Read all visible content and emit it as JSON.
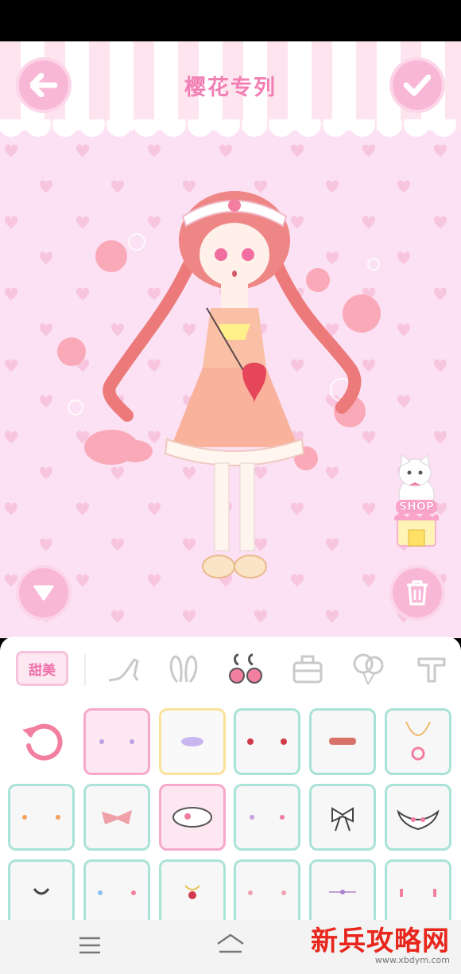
{
  "header": {
    "title": "樱花专列"
  },
  "colors": {
    "accent_pink": "#f9b7d6",
    "title_pink": "#f27fb4",
    "grid_mint": "#a9e3d6",
    "selected_pink": "#f6a9cb"
  },
  "side": {
    "shop_label": "SHOP"
  },
  "panel": {
    "style_tab": "甜美",
    "category_icons": [
      "shoe-icon",
      "bunny-ears-icon",
      "earrings-icon",
      "bag-icon",
      "balloons-icon",
      "text-icon"
    ],
    "selected_category": "earrings-icon"
  },
  "grid": {
    "rows": 3,
    "columns": 5,
    "first_cell": "reset-icon",
    "selected_items": [
      2,
      8
    ]
  },
  "watermark": {
    "brand_main": "新兵攻略网",
    "brand_url": "www.xbdym.com"
  }
}
